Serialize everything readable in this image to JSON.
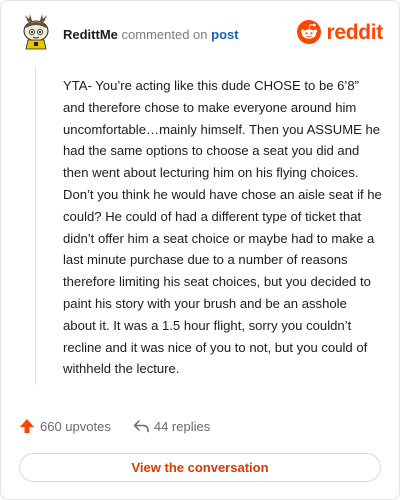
{
  "header": {
    "username": "RedittMe",
    "action_text": "commented on",
    "post_link": "post",
    "logo_text": "reddit"
  },
  "comment": {
    "text": "YTA- You’re acting like this dude CHOSE to be 6’8” and therefore chose to make everyone around him uncomfortable…mainly himself. Then you ASSUME he had the same options to choose a seat you did and then went about lecturing him on his flying choices. Don’t you think he would have chose an aisle seat if he could? He could of had a different type of ticket that didn’t offer him a seat choice or maybe had to make a last minute purchase due to a number of reasons therefore limiting his seat choices, but you decided to paint his story with your brush and be an asshole about it. It was a 1.5 hour flight, sorry you couldn’t recline and it was nice of you to not, but you could of withheld the lecture."
  },
  "actions": {
    "upvotes": "660 upvotes",
    "replies": "44 replies",
    "upvote_icon": "arrow-up-icon",
    "reply_icon": "reply-arrow-icon"
  },
  "button": {
    "label": "View the conversation"
  },
  "colors": {
    "brand": "#ff4500",
    "link": "#1a5fb4",
    "button_text": "#d93a00"
  }
}
